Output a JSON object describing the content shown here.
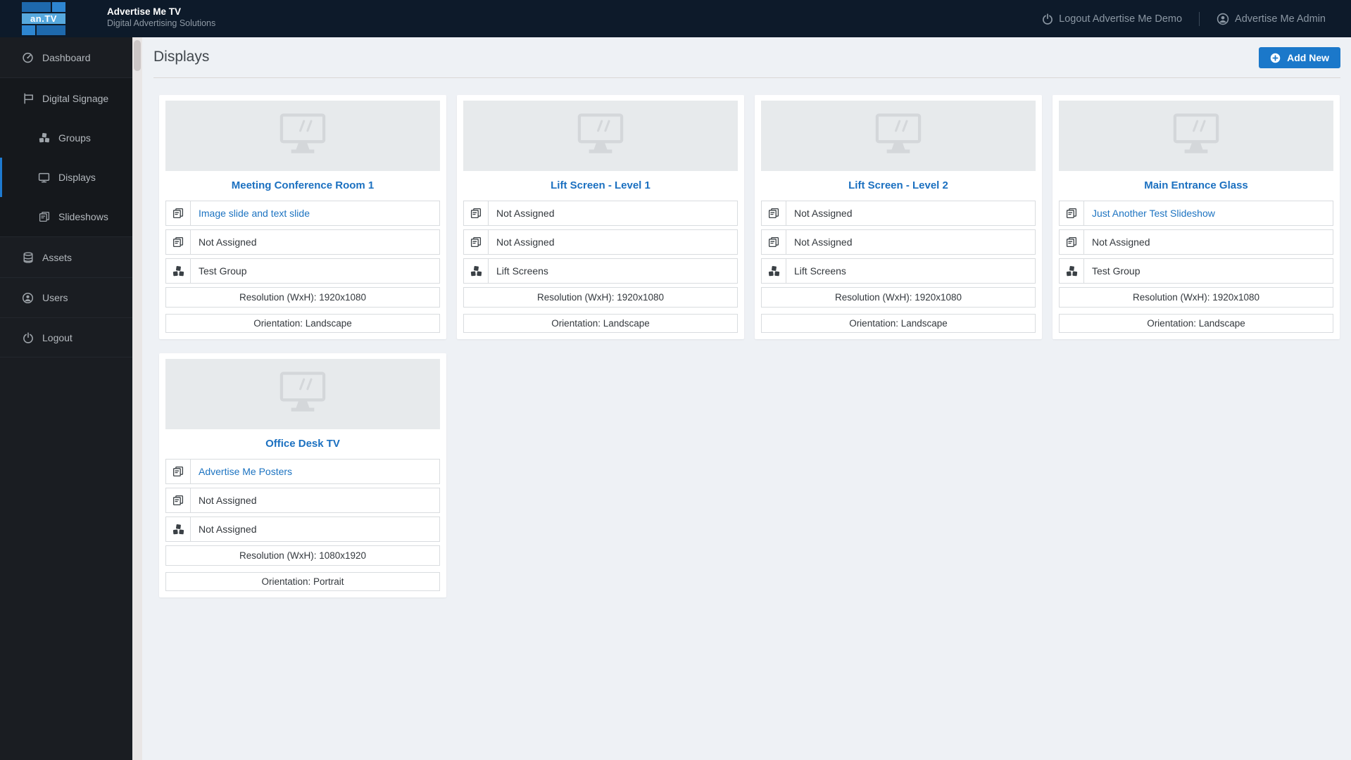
{
  "colors": {
    "accent": "#1b78ca",
    "header-bg": "#0d1a2a",
    "sidebar-bg": "#1a1d22",
    "link": "#1c73c1",
    "page-bg": "#eef1f5"
  },
  "header": {
    "logo_text": "an.TV",
    "brand_title": "Advertise Me TV",
    "brand_subtitle": "Digital Advertising Solutions",
    "logout_label": "Logout Advertise Me Demo",
    "user_label": "Advertise Me Admin"
  },
  "sidebar": {
    "items": [
      {
        "label": "Dashboard",
        "icon": "gauge-icon"
      },
      {
        "label": "Digital Signage",
        "icon": "sign-icon"
      },
      {
        "label": "Groups",
        "icon": "cubes-icon"
      },
      {
        "label": "Displays",
        "icon": "monitor-icon",
        "active": true
      },
      {
        "label": "Slideshows",
        "icon": "clone-icon"
      },
      {
        "label": "Assets",
        "icon": "database-icon"
      },
      {
        "label": "Users",
        "icon": "user-circle-icon"
      },
      {
        "label": "Logout",
        "icon": "power-icon"
      }
    ]
  },
  "page": {
    "title": "Displays",
    "add_button_label": "Add New"
  },
  "labels": {
    "not_assigned": "Not Assigned"
  },
  "cards": [
    {
      "title": "Meeting Conference Room 1",
      "slideshow1": "Image slide and text slide",
      "slideshow2": "Not Assigned",
      "group": "Test Group",
      "resolution": "Resolution (WxH): 1920x1080",
      "orientation": "Orientation: Landscape"
    },
    {
      "title": "Lift Screen - Level 1",
      "slideshow1": "Not Assigned",
      "slideshow2": "Not Assigned",
      "group": "Lift Screens",
      "resolution": "Resolution (WxH): 1920x1080",
      "orientation": "Orientation: Landscape"
    },
    {
      "title": "Lift Screen - Level 2",
      "slideshow1": "Not Assigned",
      "slideshow2": "Not Assigned",
      "group": "Lift Screens",
      "resolution": "Resolution (WxH): 1920x1080",
      "orientation": "Orientation: Landscape"
    },
    {
      "title": "Main Entrance Glass",
      "slideshow1": "Just Another Test Slideshow",
      "slideshow2": "Not Assigned",
      "group": "Test Group",
      "resolution": "Resolution (WxH): 1920x1080",
      "orientation": "Orientation: Landscape"
    },
    {
      "title": "Office Desk TV",
      "slideshow1": "Advertise Me Posters",
      "slideshow2": "Not Assigned",
      "group": "Not Assigned",
      "resolution": "Resolution (WxH): 1080x1920",
      "orientation": "Orientation: Portrait"
    }
  ]
}
